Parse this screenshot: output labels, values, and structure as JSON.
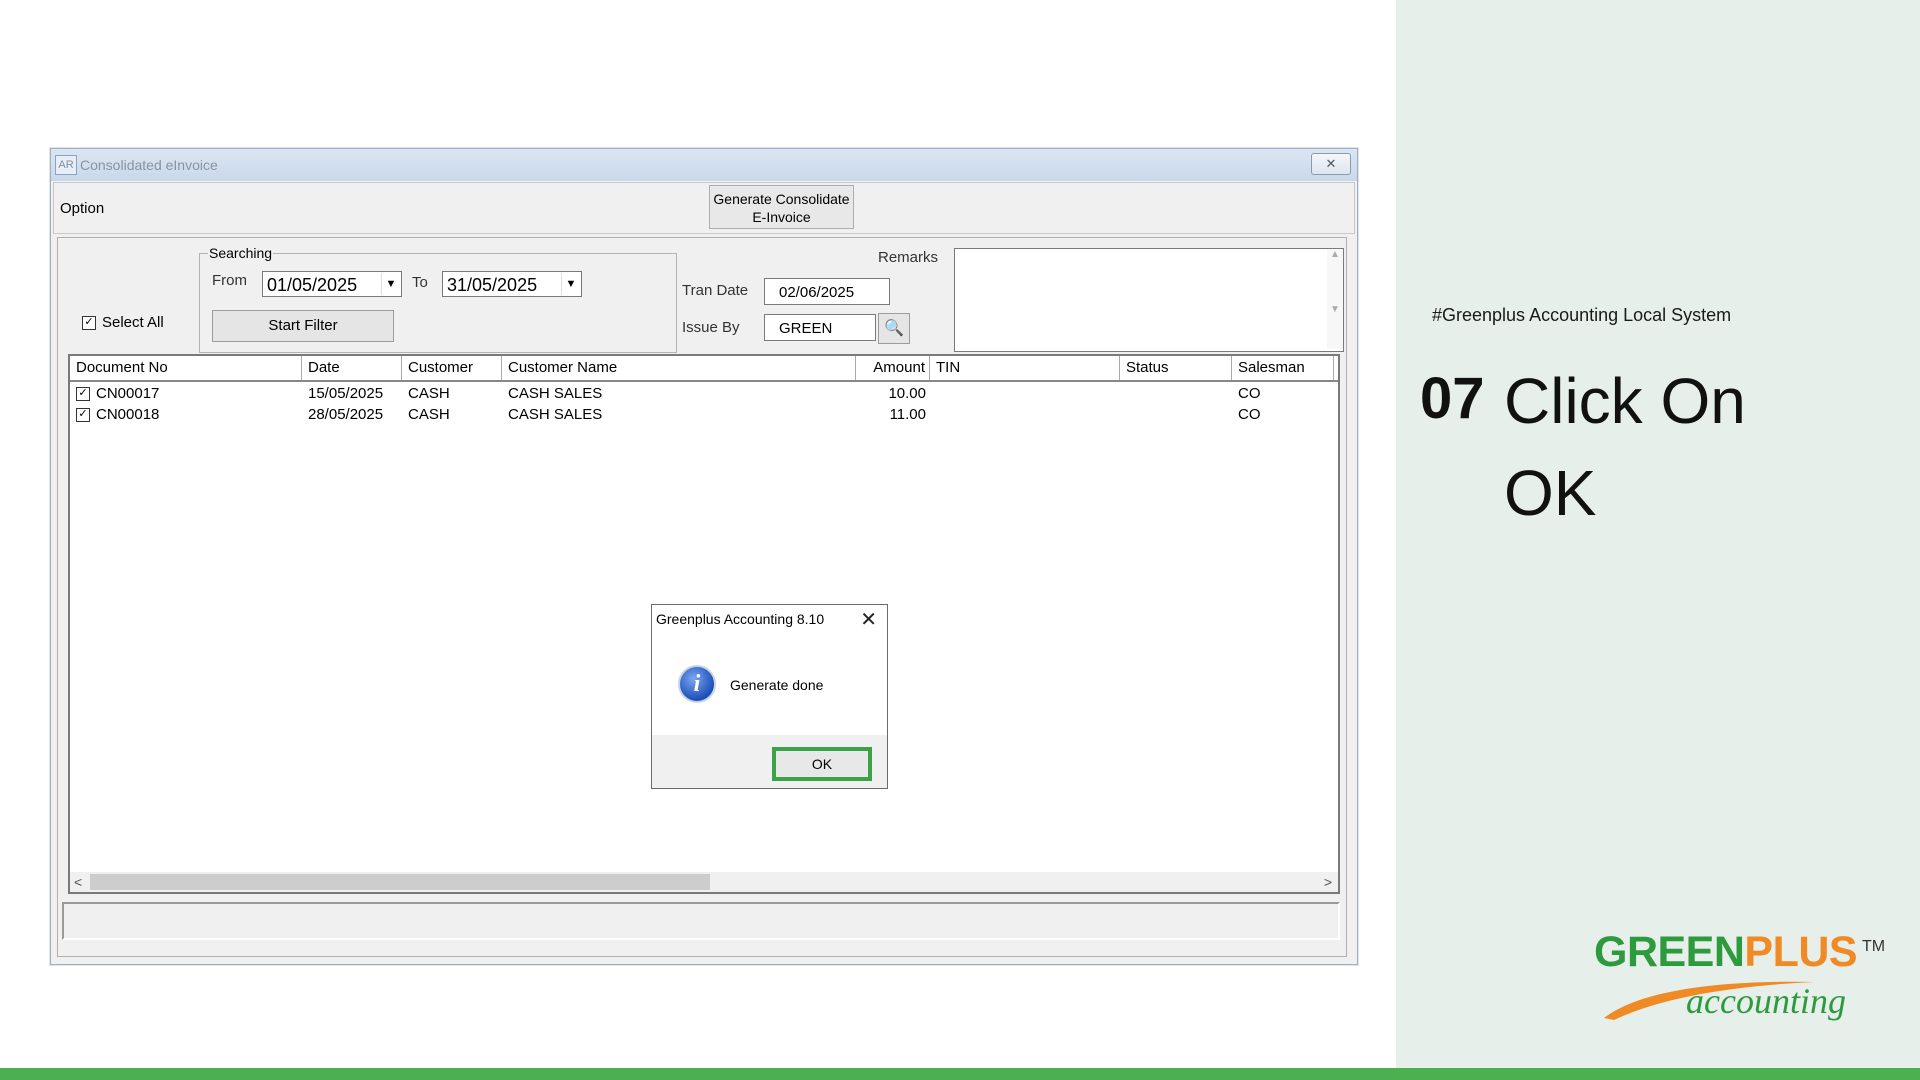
{
  "window": {
    "title": "Consolidated eInvoice",
    "icon_text": "AR",
    "option_label": "Option",
    "generate_button": "Generate Consolidate E-Invoice"
  },
  "filters": {
    "select_all_label": "Select All",
    "select_all_checked": true,
    "searching_label": "Searching",
    "from_label": "From",
    "from_value": "01/05/2025",
    "to_label": "To",
    "to_value": "31/05/2025",
    "start_filter_label": "Start Filter",
    "tran_date_label": "Tran Date",
    "tran_date_value": "02/06/2025",
    "issue_by_label": "Issue By",
    "issue_by_value": "GREEN",
    "remarks_label": "Remarks"
  },
  "table": {
    "columns": [
      "Document No",
      "Date",
      "Customer",
      "Customer Name",
      "Amount",
      "TIN",
      "Status",
      "Salesman"
    ],
    "rows": [
      {
        "checked": true,
        "doc_no": "CN00017",
        "date": "15/05/2025",
        "customer": "CASH",
        "customer_name": "CASH SALES",
        "amount": "10.00",
        "tin": "",
        "status": "",
        "salesman": "CO"
      },
      {
        "checked": true,
        "doc_no": "CN00018",
        "date": "28/05/2025",
        "customer": "CASH",
        "customer_name": "CASH SALES",
        "amount": "11.00",
        "tin": "",
        "status": "",
        "salesman": "CO"
      }
    ]
  },
  "dialog": {
    "title": "Greenplus Accounting 8.10",
    "message": "Generate done",
    "ok_label": "OK",
    "highlight_color": "#3aa348"
  },
  "instructions": {
    "hashtag": "#Greenplus Accounting Local System",
    "step_number": "07",
    "step_text": "Click On OK"
  },
  "brand": {
    "logo_green": "GREEN",
    "logo_plus": "PLUS",
    "logo_accounting": "accounting",
    "trademark": "TM",
    "panel_color": "#e6efea",
    "bar_color": "#4caf50"
  }
}
